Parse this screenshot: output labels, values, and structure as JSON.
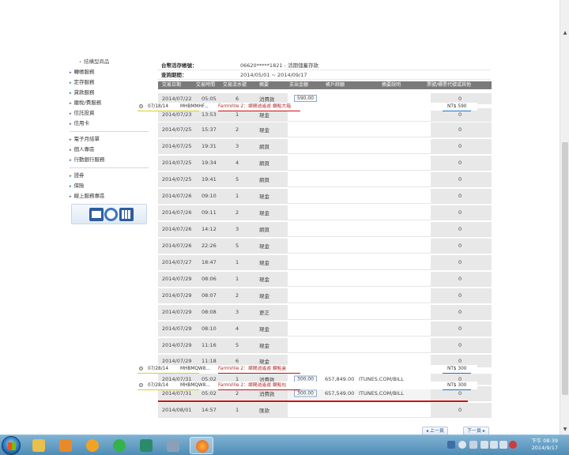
{
  "sidebar": {
    "group1": [
      "結構型商品"
    ],
    "group2": [
      "轉帳服務",
      "定存服務",
      "貸款服務",
      "繳稅/費服務",
      "信託投資",
      "信用卡"
    ],
    "group3": [
      "電子月結單",
      "個人專區",
      "行動銀行服務"
    ],
    "group4": [
      "證券",
      "保險",
      "線上服務專區"
    ]
  },
  "account": {
    "account_label": "台幣活存帳號：",
    "account_value": "06620*****1821 - 活期儲蓄存款",
    "period_label": "查詢期間：",
    "period_value": "2014/05/01 ~ 2014/09/17"
  },
  "table": {
    "headers": [
      "交易日期",
      "交易時間",
      "交易流水號",
      "摘要",
      "支出金額",
      "帳戶餘額",
      "摘要說明",
      "票號/標票代號或其他"
    ],
    "rows": [
      {
        "date": "2014/07/22",
        "time": "05:05",
        "seq": "6",
        "summary": "消費款",
        "amount": "590.00",
        "balance": "",
        "desc": "",
        "extra": "0"
      },
      {
        "date": "2014/07/23",
        "time": "13:53",
        "seq": "1",
        "summary": "現金",
        "amount": "",
        "balance": "",
        "desc": "",
        "extra": "0"
      },
      {
        "date": "2014/07/25",
        "time": "15:37",
        "seq": "2",
        "summary": "現金",
        "amount": "",
        "balance": "",
        "desc": "",
        "extra": "0"
      },
      {
        "date": "2014/07/25",
        "time": "19:31",
        "seq": "3",
        "summary": "網頁",
        "amount": "",
        "balance": "",
        "desc": "",
        "extra": "0"
      },
      {
        "date": "2014/07/25",
        "time": "19:34",
        "seq": "4",
        "summary": "網頁",
        "amount": "",
        "balance": "",
        "desc": "",
        "extra": "0"
      },
      {
        "date": "2014/07/25",
        "time": "19:41",
        "seq": "5",
        "summary": "網頁",
        "amount": "",
        "balance": "",
        "desc": "",
        "extra": "0"
      },
      {
        "date": "2014/07/26",
        "time": "09:10",
        "seq": "1",
        "summary": "現金",
        "amount": "",
        "balance": "",
        "desc": "",
        "extra": "0"
      },
      {
        "date": "2014/07/26",
        "time": "09:11",
        "seq": "2",
        "summary": "現金",
        "amount": "",
        "balance": "",
        "desc": "",
        "extra": "0"
      },
      {
        "date": "2014/07/26",
        "time": "14:12",
        "seq": "3",
        "summary": "網頁",
        "amount": "",
        "balance": "",
        "desc": "",
        "extra": "0"
      },
      {
        "date": "2014/07/26",
        "time": "22:26",
        "seq": "5",
        "summary": "現金",
        "amount": "",
        "balance": "",
        "desc": "",
        "extra": "0"
      },
      {
        "date": "2014/07/27",
        "time": "18:47",
        "seq": "1",
        "summary": "現金",
        "amount": "",
        "balance": "",
        "desc": "",
        "extra": "0"
      },
      {
        "date": "2014/07/29",
        "time": "08:06",
        "seq": "1",
        "summary": "現金",
        "amount": "",
        "balance": "",
        "desc": "",
        "extra": "0"
      },
      {
        "date": "2014/07/29",
        "time": "08:07",
        "seq": "2",
        "summary": "現金",
        "amount": "",
        "balance": "",
        "desc": "",
        "extra": "0"
      },
      {
        "date": "2014/07/29",
        "time": "08:08",
        "seq": "3",
        "summary": "更正",
        "amount": "",
        "balance": "",
        "desc": "",
        "extra": "0"
      },
      {
        "date": "2014/07/29",
        "time": "08:10",
        "seq": "4",
        "summary": "現金",
        "amount": "",
        "balance": "",
        "desc": "",
        "extra": "0"
      },
      {
        "date": "2014/07/29",
        "time": "11:16",
        "seq": "5",
        "summary": "現金",
        "amount": "",
        "balance": "",
        "desc": "",
        "extra": "0"
      },
      {
        "date": "2014/07/29",
        "time": "11:18",
        "seq": "6",
        "summary": "現金",
        "amount": "",
        "balance": "",
        "desc": "",
        "extra": "0"
      },
      {
        "date": "2014/07/31",
        "time": "05:02",
        "seq": "1",
        "summary": "消費款",
        "amount": "300.00",
        "balance": "657,849.00",
        "desc": "ITUNES.COM/BILL",
        "extra": "0"
      },
      {
        "date": "2014/07/31",
        "time": "05:02",
        "seq": "2",
        "summary": "消費款",
        "amount": "300.00",
        "balance": "657,549.00",
        "desc": "ITUNES.COM/BILL",
        "extra": "0"
      },
      {
        "date": "2014/08/01",
        "time": "14:57",
        "seq": "1",
        "summary": "匯款",
        "amount": "",
        "balance": "",
        "desc": "",
        "extra": "0"
      }
    ]
  },
  "popups": [
    {
      "date": "07/18/14",
      "code": "MHBMMHF...",
      "cat": "FarmVille 2：",
      "desc": "鄉間逍遙遊 鑽點大箱",
      "price": "NT$ 590"
    },
    {
      "date": "07/28/14",
      "code": "MHBMQW8...",
      "cat": "FarmVille 2：",
      "desc": "鄉間逍遙遊 鑽點盒",
      "price": "NT$ 300"
    },
    {
      "date": "07/28/14",
      "code": "MHBMQW8...",
      "cat": "FarmVille 2：",
      "desc": "鄉間逍遙遊 鑽點包",
      "price": "NT$ 300"
    }
  ],
  "pager": {
    "prev": "◂ 上一頁",
    "next": "下一頁 ▸"
  },
  "taskbar": {
    "time": "下午 08:39",
    "date": "2014/9/17"
  },
  "colors": {
    "accent": "#2e5d9e",
    "header_bg": "#7a7a7a",
    "highlight_red": "#d01010",
    "underline_yellow": "#d8d020",
    "underline_blue": "#1a78c8"
  }
}
